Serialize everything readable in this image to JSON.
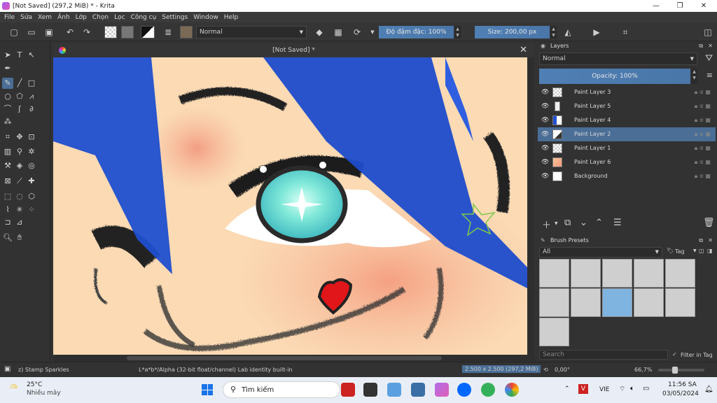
{
  "window": {
    "title": "[Not Saved]  (297,2 MiB)  * - Krita",
    "min_glyph": "—",
    "max_glyph": "❐",
    "close_glyph": "✕"
  },
  "menu": [
    "File",
    "Sửa",
    "Xem",
    "Ảnh",
    "Lớp",
    "Chọn",
    "Lọc",
    "Công cụ",
    "Settings",
    "Window",
    "Help"
  ],
  "toolbar": {
    "blend_mode": "Normal",
    "opacity_label": "Độ đậm đặc: 100%",
    "size_label": "Size: 200,00 px"
  },
  "canvas": {
    "title": "[Not Saved]  *",
    "close_glyph": "✕"
  },
  "layers_docker": {
    "title": "Layers",
    "blend_mode": "Normal",
    "opacity_label": "Opacity:  100%",
    "layers": [
      {
        "name": "Paint Layer 3",
        "selected": false
      },
      {
        "name": "Paint Layer 5",
        "selected": false
      },
      {
        "name": "Paint Layer 4",
        "selected": false
      },
      {
        "name": "Paint Layer 2",
        "selected": true
      },
      {
        "name": "Paint Layer 1",
        "selected": false
      },
      {
        "name": "Paint Layer 6",
        "selected": false
      },
      {
        "name": "Background",
        "selected": false
      }
    ]
  },
  "brush_presets": {
    "title": "Brush Presets",
    "filter": "All",
    "tag_label": "Tag",
    "search_placeholder": "Search",
    "filter_in_tag_label": "Filter in Tag"
  },
  "status": {
    "brush": "z) Stamp Sparkles",
    "color_space": "L*a*b*/Alpha (32-bit float/channel)  Lab identity built-in",
    "dimensions": "2.500 x 2.500 (297,2 MiB)",
    "rotation": "0,00°",
    "zoom": "66,7%"
  },
  "taskbar": {
    "weather_temp": "25°C",
    "weather_desc": "Nhiều mây",
    "search_label": "Tìm kiếm",
    "lang": "VIE",
    "time": "11:56 SA",
    "date": "03/05/2024"
  },
  "colors": {
    "accent": "#4a6e96",
    "hair_blue": "#1f4fd0",
    "skin": "#fbd9b4",
    "blush": "#f4a585",
    "heart_red": "#e0161a"
  }
}
